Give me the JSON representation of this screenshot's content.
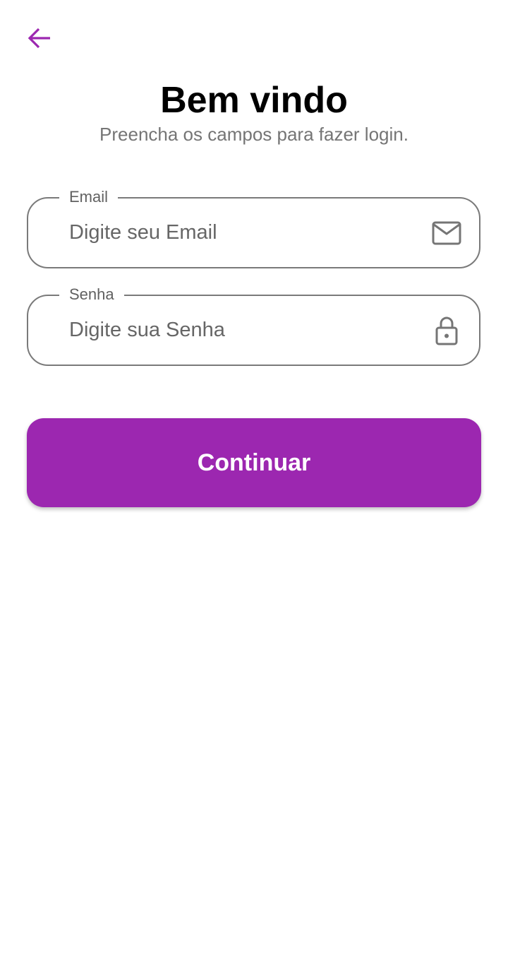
{
  "header": {
    "back_icon": "arrow-back-icon"
  },
  "welcome": {
    "title": "Bem vindo",
    "subtitle": "Preencha os campos para fazer login."
  },
  "form": {
    "email": {
      "label": "Email",
      "placeholder": "Digite seu Email",
      "value": "",
      "icon": "mail-icon"
    },
    "senha": {
      "label": "Senha",
      "placeholder": "Digite sua Senha",
      "value": "",
      "icon": "lock-icon"
    }
  },
  "actions": {
    "continue_label": "Continuar"
  },
  "colors": {
    "accent": "#9c27b0",
    "border": "#7a7a7a",
    "subtitle": "#757575"
  }
}
